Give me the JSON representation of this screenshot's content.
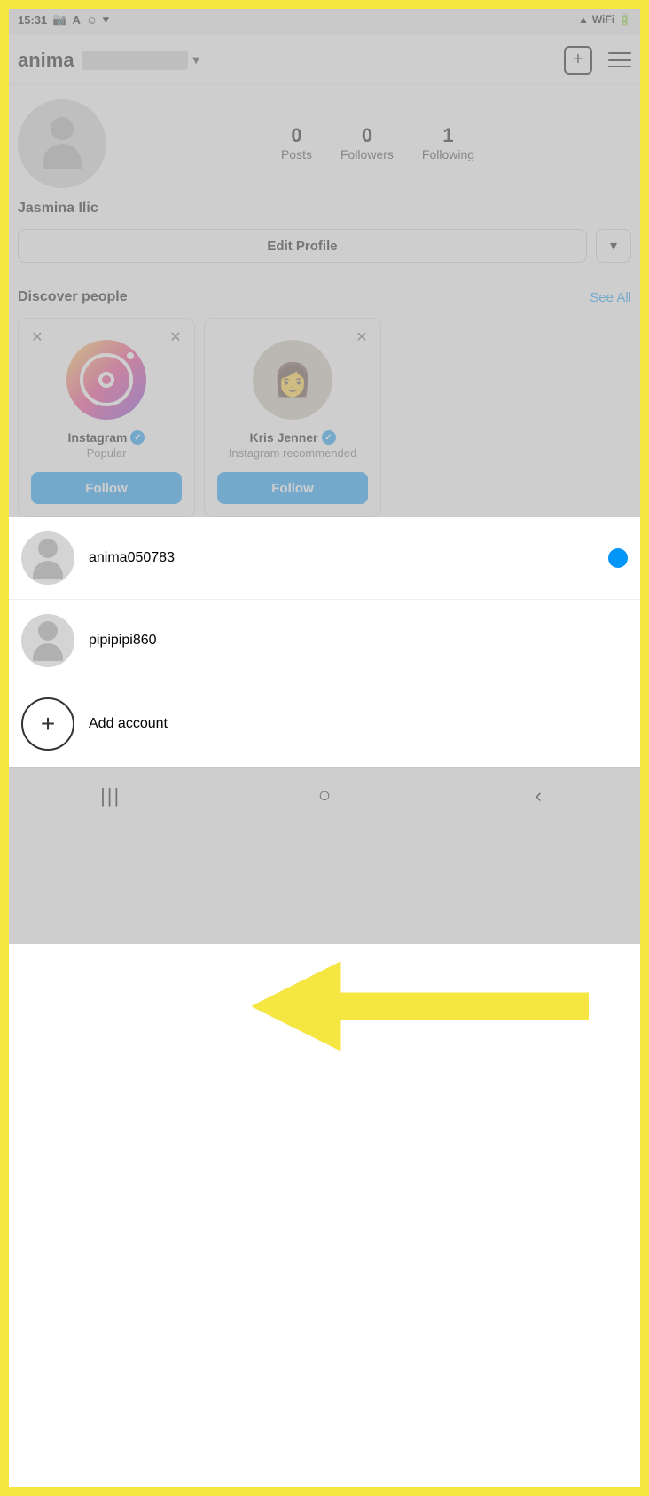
{
  "statusBar": {
    "time": "15:31",
    "rightIcons": [
      "camera-icon",
      "text-a-icon",
      "face-icon",
      "chevron-icon",
      "signal-icon",
      "wifi-icon",
      "battery-icon"
    ]
  },
  "topNav": {
    "username": "anima",
    "addIcon": "+",
    "dropdownLabel": "▾"
  },
  "profile": {
    "name": "Jasmina Ilic",
    "stats": [
      {
        "label": "Posts",
        "value": "0"
      },
      {
        "label": "Followers",
        "value": "0"
      },
      {
        "label": "Following",
        "value": "1"
      }
    ],
    "editProfileLabel": "Edit Profile",
    "dropdownChevron": "▾"
  },
  "discoverPeople": {
    "title": "Discover people",
    "seeAllLabel": "See All",
    "suggestions": [
      {
        "name": "Instagram",
        "subtitle": "Popular",
        "type": "logo",
        "followLabel": "Follow",
        "verified": true
      },
      {
        "name": "Kris Jenner",
        "subtitle": "Instagram\nrecommended",
        "type": "person",
        "followLabel": "Follow",
        "verified": true
      }
    ]
  },
  "accountSwitcher": {
    "accounts": [
      {
        "username": "anima050783",
        "active": true
      },
      {
        "username": "pipipipi860",
        "active": false
      }
    ],
    "addAccountLabel": "Add account"
  },
  "bottomNav": {
    "icons": [
      "|||",
      "○",
      "<"
    ]
  },
  "arrowAnnotation": {
    "color": "#f5e642"
  }
}
